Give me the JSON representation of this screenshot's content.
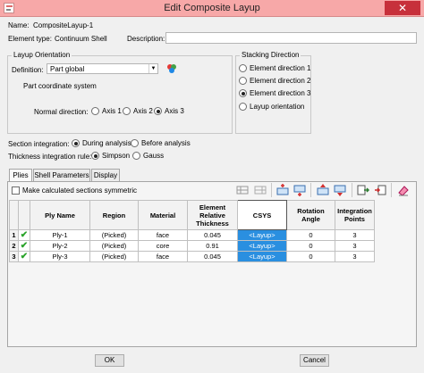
{
  "window": {
    "title": "Edit Composite Layup",
    "close_glyph": "✕"
  },
  "header": {
    "name_label": "Name:",
    "name_value": "CompositeLayup-1",
    "element_type_label": "Element type:",
    "element_type_value": "Continuum Shell",
    "description_label": "Description:",
    "description_value": ""
  },
  "layup_orientation": {
    "title": "Layup Orientation",
    "definition_label": "Definition:",
    "definition_value": "Part global",
    "coord_text": "Part coordinate system",
    "normal_direction_label": "Normal direction:",
    "axes": [
      {
        "label": "Axis 1",
        "selected": false
      },
      {
        "label": "Axis 2",
        "selected": false
      },
      {
        "label": "Axis 3",
        "selected": true
      }
    ]
  },
  "stacking_direction": {
    "title": "Stacking Direction",
    "options": [
      {
        "label": "Element direction 1",
        "selected": false
      },
      {
        "label": "Element direction 2",
        "selected": false
      },
      {
        "label": "Element direction 3",
        "selected": true
      },
      {
        "label": "Layup orientation",
        "selected": false
      }
    ]
  },
  "section_integration": {
    "label": "Section integration:",
    "options": [
      {
        "label": "During analysis",
        "selected": true
      },
      {
        "label": "Before analysis",
        "selected": false
      }
    ]
  },
  "thickness_rule": {
    "label": "Thickness integration rule:",
    "options": [
      {
        "label": "Simpson",
        "selected": true
      },
      {
        "label": "Gauss",
        "selected": false
      }
    ]
  },
  "tabs": [
    {
      "label": "Plies",
      "active": true
    },
    {
      "label": "Shell Parameters",
      "active": false
    },
    {
      "label": "Display",
      "active": false
    }
  ],
  "plies": {
    "symmetric_label": "Make calculated sections symmetric",
    "columns": {
      "ply_name": "Ply Name",
      "region": "Region",
      "material": "Material",
      "thickness": [
        "Element",
        "Relative",
        "Thickness"
      ],
      "csys": "CSYS",
      "rotation": [
        "Rotation",
        "Angle"
      ],
      "integration": [
        "Integration",
        "Points"
      ]
    },
    "rows": [
      {
        "num": "1",
        "check": "✔",
        "name": "Ply-1",
        "region": "(Picked)",
        "material": "face",
        "thickness": "0.045",
        "csys": "<Layup>",
        "rotation": "0",
        "points": "3"
      },
      {
        "num": "2",
        "check": "✔",
        "name": "Ply-2",
        "region": "(Picked)",
        "material": "core",
        "thickness": "0.91",
        "csys": "<Layup>",
        "rotation": "0",
        "points": "3"
      },
      {
        "num": "3",
        "check": "✔",
        "name": "Ply-3",
        "region": "(Picked)",
        "material": "face",
        "thickness": "0.045",
        "csys": "<Layup>",
        "rotation": "0",
        "points": "3"
      }
    ]
  },
  "buttons": {
    "ok": "OK",
    "cancel": "Cancel"
  },
  "colors": {
    "titlebar": "#f7a8a8",
    "close": "#c7303b",
    "selection": "#2a8fe0",
    "check": "#29a329"
  }
}
